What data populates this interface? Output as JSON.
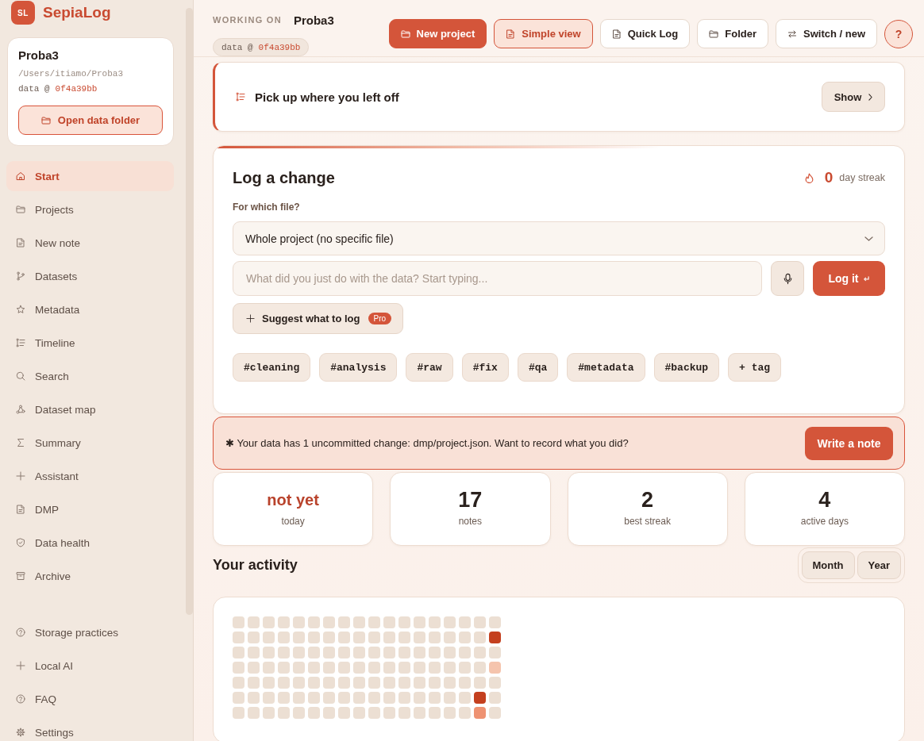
{
  "sidebar": {
    "logo": {
      "initials": "SL",
      "name": "SepiaLog"
    },
    "project": {
      "name": "Proba3",
      "path": "/Users/itiamo/Proba3",
      "data_label": "data @",
      "commit": "0f4a39bb",
      "open_button": "Open data folder"
    },
    "nav": [
      {
        "label": "Start",
        "selected": true
      },
      {
        "label": "Projects",
        "selected": false
      },
      {
        "label": "New note",
        "selected": false
      },
      {
        "label": "Datasets",
        "selected": false
      },
      {
        "label": "Metadata",
        "selected": false
      },
      {
        "label": "Timeline",
        "selected": false
      },
      {
        "label": "Search",
        "selected": false
      },
      {
        "label": "Dataset map",
        "selected": false
      },
      {
        "label": "Summary",
        "selected": false
      },
      {
        "label": "Assistant",
        "selected": false
      },
      {
        "label": "DMP",
        "selected": false
      },
      {
        "label": "Data health",
        "selected": false
      },
      {
        "label": "Archive",
        "selected": false
      }
    ],
    "footer_nav": [
      {
        "label": "Storage practices",
        "selected": false
      },
      {
        "label": "Local AI",
        "selected": false
      },
      {
        "label": "FAQ",
        "selected": false
      },
      {
        "label": "Settings",
        "selected": false
      }
    ]
  },
  "header": {
    "working_on": "WORKING ON",
    "project": "Proba3",
    "data_label": "data @",
    "commit": "0f4a39bb",
    "buttons": [
      {
        "label": "New project",
        "kind": "primary"
      },
      {
        "label": "Simple view",
        "kind": "soft"
      },
      {
        "label": "Quick Log",
        "kind": "outline"
      },
      {
        "label": "Folder",
        "kind": "outline"
      },
      {
        "label": "Switch / new",
        "kind": "outline"
      }
    ],
    "help_button": "?"
  },
  "resume": {
    "title": "Pick up where you left off",
    "button": "Show"
  },
  "log": {
    "title": "Log a change",
    "streak": {
      "count": "0",
      "label": "day streak"
    },
    "file_label": "For which file?",
    "file_select": {
      "value": "Whole project (no specific file)"
    },
    "note_input": {
      "placeholder": "What did you just do with the data? Start typing..."
    },
    "submit": {
      "label": "Log it",
      "key_hint": "↵"
    },
    "suggest": {
      "label": "Suggest what to log",
      "badge": "Pro"
    },
    "tags": [
      "#cleaning",
      "#analysis",
      "#raw",
      "#fix",
      "#qa",
      "#metadata",
      "#backup"
    ],
    "add_tag": "+ tag"
  },
  "banner": {
    "message": "✱ Your data has 1 uncommitted change: dmp/project.json. Want to record what you did?",
    "button": "Write a note"
  },
  "stats": [
    {
      "value": "not yet",
      "label": "today",
      "kind": "status"
    },
    {
      "value": "17",
      "label": "notes",
      "kind": "count"
    },
    {
      "value": "2",
      "label": "best streak",
      "kind": "count"
    },
    {
      "value": "4",
      "label": "active days",
      "kind": "count"
    }
  ],
  "activity": {
    "title": "Your activity",
    "ranges": [
      {
        "label": "Month",
        "selected": false
      },
      {
        "label": "Year",
        "selected": false
      }
    ],
    "rows": [
      {
        "cells": [
          {
            "color": "#ecdfd3"
          },
          {
            "color": "#ecdfd3"
          },
          {
            "color": "#ecdfd3"
          },
          {
            "color": "#ecdfd3"
          },
          {
            "color": "#ecdfd3"
          },
          {
            "color": "#ecdfd3"
          },
          {
            "color": "#ecdfd3"
          },
          {
            "color": "#ecdfd3"
          },
          {
            "color": "#ecdfd3"
          },
          {
            "color": "#ecdfd3"
          },
          {
            "color": "#ecdfd3"
          },
          {
            "color": "#ecdfd3"
          },
          {
            "color": "#ecdfd3"
          },
          {
            "color": "#ecdfd3"
          },
          {
            "color": "#ecdfd3"
          },
          {
            "color": "#ecdfd3"
          },
          {
            "color": "#ecdfd3"
          },
          {
            "color": "#ecdfd3"
          }
        ]
      },
      {
        "cells": [
          {
            "color": "#ecdfd3"
          },
          {
            "color": "#ecdfd3"
          },
          {
            "color": "#ecdfd3"
          },
          {
            "color": "#ecdfd3"
          },
          {
            "color": "#ecdfd3"
          },
          {
            "color": "#ecdfd3"
          },
          {
            "color": "#ecdfd3"
          },
          {
            "color": "#ecdfd3"
          },
          {
            "color": "#ecdfd3"
          },
          {
            "color": "#ecdfd3"
          },
          {
            "color": "#ecdfd3"
          },
          {
            "color": "#ecdfd3"
          },
          {
            "color": "#ecdfd3"
          },
          {
            "color": "#ecdfd3"
          },
          {
            "color": "#ecdfd3"
          },
          {
            "color": "#ecdfd3"
          },
          {
            "color": "#ecdfd3"
          },
          {
            "color": "#c4401f"
          }
        ]
      },
      {
        "cells": [
          {
            "color": "#ecdfd3"
          },
          {
            "color": "#ecdfd3"
          },
          {
            "color": "#ecdfd3"
          },
          {
            "color": "#ecdfd3"
          },
          {
            "color": "#ecdfd3"
          },
          {
            "color": "#ecdfd3"
          },
          {
            "color": "#ecdfd3"
          },
          {
            "color": "#ecdfd3"
          },
          {
            "color": "#ecdfd3"
          },
          {
            "color": "#ecdfd3"
          },
          {
            "color": "#ecdfd3"
          },
          {
            "color": "#ecdfd3"
          },
          {
            "color": "#ecdfd3"
          },
          {
            "color": "#ecdfd3"
          },
          {
            "color": "#ecdfd3"
          },
          {
            "color": "#ecdfd3"
          },
          {
            "color": "#ecdfd3"
          },
          {
            "color": "#ecdfd3"
          }
        ]
      },
      {
        "cells": [
          {
            "color": "#ecdfd3"
          },
          {
            "color": "#ecdfd3"
          },
          {
            "color": "#ecdfd3"
          },
          {
            "color": "#ecdfd3"
          },
          {
            "color": "#ecdfd3"
          },
          {
            "color": "#ecdfd3"
          },
          {
            "color": "#ecdfd3"
          },
          {
            "color": "#ecdfd3"
          },
          {
            "color": "#ecdfd3"
          },
          {
            "color": "#ecdfd3"
          },
          {
            "color": "#ecdfd3"
          },
          {
            "color": "#ecdfd3"
          },
          {
            "color": "#ecdfd3"
          },
          {
            "color": "#ecdfd3"
          },
          {
            "color": "#ecdfd3"
          },
          {
            "color": "#ecdfd3"
          },
          {
            "color": "#ecdfd3"
          },
          {
            "color": "#f5c4ad"
          }
        ]
      },
      {
        "cells": [
          {
            "color": "#ecdfd3"
          },
          {
            "color": "#ecdfd3"
          },
          {
            "color": "#ecdfd3"
          },
          {
            "color": "#ecdfd3"
          },
          {
            "color": "#ecdfd3"
          },
          {
            "color": "#ecdfd3"
          },
          {
            "color": "#ecdfd3"
          },
          {
            "color": "#ecdfd3"
          },
          {
            "color": "#ecdfd3"
          },
          {
            "color": "#ecdfd3"
          },
          {
            "color": "#ecdfd3"
          },
          {
            "color": "#ecdfd3"
          },
          {
            "color": "#ecdfd3"
          },
          {
            "color": "#ecdfd3"
          },
          {
            "color": "#ecdfd3"
          },
          {
            "color": "#ecdfd3"
          },
          {
            "color": "#ecdfd3"
          },
          {
            "color": "#ecdfd3"
          }
        ]
      },
      {
        "cells": [
          {
            "color": "#ecdfd3"
          },
          {
            "color": "#ecdfd3"
          },
          {
            "color": "#ecdfd3"
          },
          {
            "color": "#ecdfd3"
          },
          {
            "color": "#ecdfd3"
          },
          {
            "color": "#ecdfd3"
          },
          {
            "color": "#ecdfd3"
          },
          {
            "color": "#ecdfd3"
          },
          {
            "color": "#ecdfd3"
          },
          {
            "color": "#ecdfd3"
          },
          {
            "color": "#ecdfd3"
          },
          {
            "color": "#ecdfd3"
          },
          {
            "color": "#ecdfd3"
          },
          {
            "color": "#ecdfd3"
          },
          {
            "color": "#ecdfd3"
          },
          {
            "color": "#ecdfd3"
          },
          {
            "color": "#c4401f"
          },
          {
            "color": "#ecdfd3"
          }
        ]
      },
      {
        "cells": [
          {
            "color": "#ecdfd3"
          },
          {
            "color": "#ecdfd3"
          },
          {
            "color": "#ecdfd3"
          },
          {
            "color": "#ecdfd3"
          },
          {
            "color": "#ecdfd3"
          },
          {
            "color": "#ecdfd3"
          },
          {
            "color": "#ecdfd3"
          },
          {
            "color": "#ecdfd3"
          },
          {
            "color": "#ecdfd3"
          },
          {
            "color": "#ecdfd3"
          },
          {
            "color": "#ecdfd3"
          },
          {
            "color": "#ecdfd3"
          },
          {
            "color": "#ecdfd3"
          },
          {
            "color": "#ecdfd3"
          },
          {
            "color": "#ecdfd3"
          },
          {
            "color": "#ecdfd3"
          },
          {
            "color": "#ee9272"
          },
          {
            "color": "#ecdfd3"
          }
        ]
      }
    ]
  }
}
